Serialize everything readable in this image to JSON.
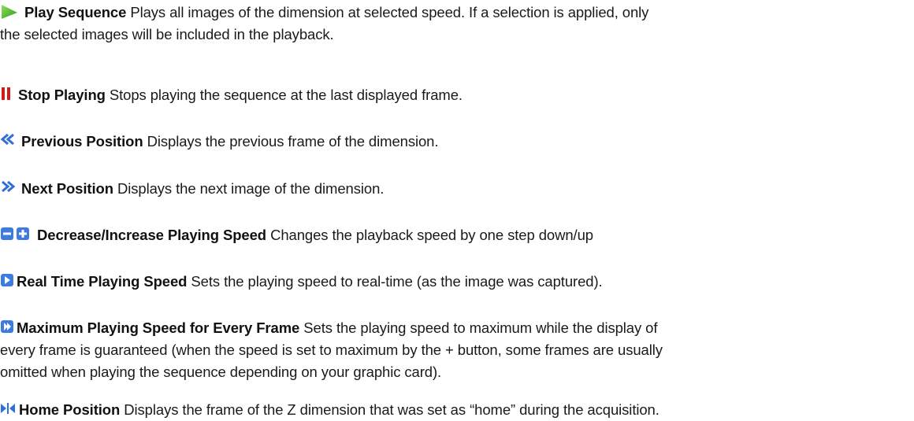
{
  "entries": [
    {
      "icon": "play-icon",
      "term": "Play Sequence",
      "desc": "Plays all images of the dimension at selected speed. If a selection is applied, only",
      "desc2": "the selected images will be included in the playback."
    },
    {
      "icon": "pause-icon",
      "term": "Stop Playing",
      "desc": "Stops playing the sequence at the last displayed frame."
    },
    {
      "icon": "rewind-icon",
      "term": "Previous Position",
      "desc": "Displays the previous frame of the dimension."
    },
    {
      "icon": "fast-forward-icon",
      "term": "Next Position",
      "desc": "Displays the next image of the dimension."
    },
    {
      "icon": "speed-decrease-increase-icon",
      "term": "Decrease/Increase Playing Speed",
      "desc": "Changes the playback speed by one step down/up"
    },
    {
      "icon": "realtime-speed-icon",
      "term": "Real Time Playing Speed",
      "desc": "Sets the playing speed to real-time (as the image was captured)."
    },
    {
      "icon": "max-speed-icon",
      "term": "Maximum Playing Speed for Every Frame",
      "desc": "Sets the playing speed to maximum while the display of",
      "desc2": "every frame is guaranteed (when the speed is set to maximum by the + button, some frames are usually",
      "desc3": "omitted when playing the sequence depending on your graphic card)."
    },
    {
      "icon": "home-position-icon",
      "term": "Home Position",
      "desc": "Displays the frame of the Z dimension that was set as “home” during the acquisition."
    }
  ]
}
